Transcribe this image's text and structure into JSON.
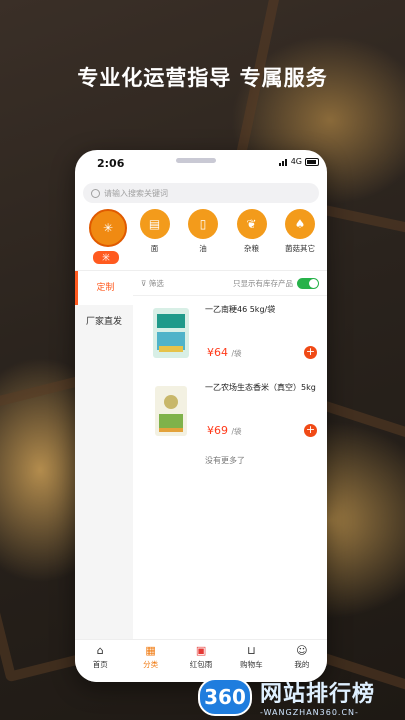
{
  "headline": "专业化运营指导 专属服务",
  "status": {
    "time": "2:06",
    "network": "4G"
  },
  "search": {
    "placeholder": "请输入搜索关键词"
  },
  "categories": [
    {
      "label": "米",
      "icon": "rice-bowl-icon",
      "active": true
    },
    {
      "label": "面",
      "icon": "flour-bag-icon"
    },
    {
      "label": "油",
      "icon": "oil-bottle-icon"
    },
    {
      "label": "杂粮",
      "icon": "wheat-icon"
    },
    {
      "label": "菌菇其它",
      "icon": "mushroom-icon"
    }
  ],
  "sidebar": [
    {
      "label": "定制",
      "active": true
    },
    {
      "label": "厂家直发"
    }
  ],
  "filter": {
    "label": "筛选",
    "stock_toggle_label": "只显示有库存产品"
  },
  "products": [
    {
      "name": "一乙南粳46 5kg/袋",
      "price": "¥64",
      "unit": "/袋"
    },
    {
      "name": "一乙农场生态香米（真空）5kg",
      "price": "¥69",
      "unit": "/袋"
    }
  ],
  "no_more": "没有更多了",
  "tabs": [
    {
      "label": "首页",
      "icon": "home-icon"
    },
    {
      "label": "分类",
      "icon": "category-icon",
      "active": true
    },
    {
      "label": "红包雨",
      "icon": "red-envelope-icon"
    },
    {
      "label": "购物车",
      "icon": "cart-icon"
    },
    {
      "label": "我的",
      "icon": "profile-icon"
    }
  ],
  "watermark": {
    "badge": "360",
    "cn": "网站排行榜",
    "en": "-WANGZHAN360.CN-"
  },
  "colors": {
    "accent": "#ff5a1f",
    "category": "#f39b1b",
    "toggle": "#27b24a"
  }
}
